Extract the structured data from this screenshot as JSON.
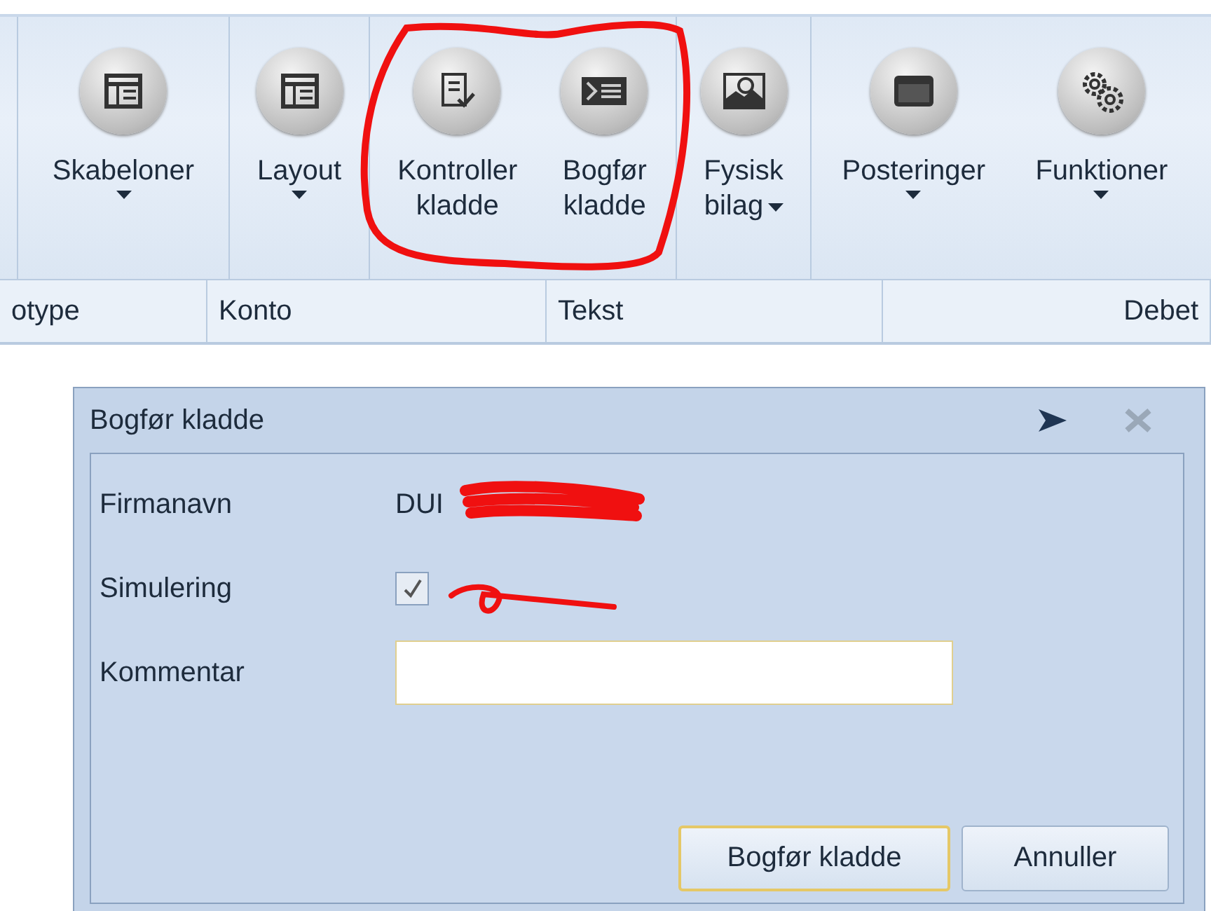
{
  "ribbon": {
    "groups": [
      {
        "buttons": [
          {
            "label_lines": [
              "Skabeloner"
            ],
            "dropdown": true
          }
        ]
      },
      {
        "buttons": [
          {
            "label_lines": [
              "Layout"
            ],
            "dropdown": true
          }
        ]
      },
      {
        "buttons": [
          {
            "label_lines": [
              "Kontroller",
              "kladde"
            ],
            "dropdown": false
          },
          {
            "label_lines": [
              "Bogfør",
              "kladde"
            ],
            "dropdown": false
          }
        ]
      },
      {
        "buttons": [
          {
            "label_lines": [
              "Fysisk",
              "bilag"
            ],
            "dropdown": true
          }
        ]
      },
      {
        "buttons": [
          {
            "label_lines": [
              "Posteringer"
            ],
            "dropdown": true
          },
          {
            "label_lines": [
              "Funktioner"
            ],
            "dropdown": true
          }
        ]
      }
    ]
  },
  "grid": {
    "columns": [
      "otype",
      "Konto",
      "Tekst",
      "Debet"
    ]
  },
  "dialog": {
    "title": "Bogfør kladde",
    "fields": [
      {
        "kind": "text",
        "label": "Firmanavn",
        "value": "DUI"
      },
      {
        "kind": "checkbox",
        "label": "Simulering",
        "checked": true
      },
      {
        "kind": "input",
        "label": "Kommentar",
        "focused": true
      }
    ],
    "buttons": [
      {
        "label": "Bogfør kladde",
        "default": true
      },
      {
        "label": "Annuller",
        "default": false
      }
    ]
  }
}
